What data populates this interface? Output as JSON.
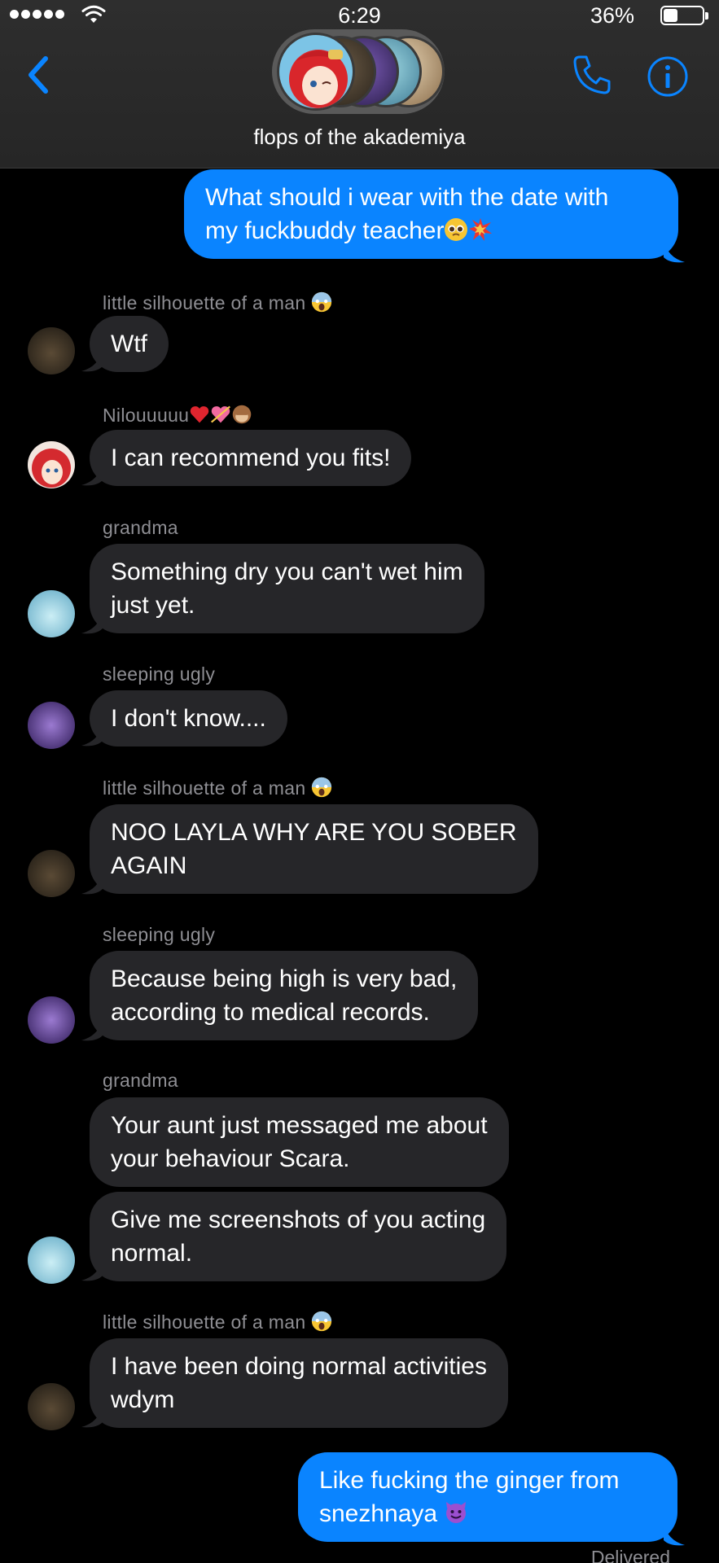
{
  "status_bar": {
    "time": "6:29",
    "battery": "36%",
    "battery_level": 0.36
  },
  "header": {
    "group_name": "flops of the akademiya"
  },
  "messages": [
    {
      "type": "outgoing",
      "text": "What should i wear with the date with my fuckbuddy teacher"
    },
    {
      "type": "incoming",
      "sender": "little silhouette of a man",
      "text": "Wtf"
    },
    {
      "type": "incoming",
      "sender": "Nilouuuuu",
      "text": "I can recommend you fits!"
    },
    {
      "type": "incoming",
      "sender": "grandma",
      "text": "Something dry you can't wet him just yet."
    },
    {
      "type": "incoming",
      "sender": "sleeping ugly",
      "text": "I don't know...."
    },
    {
      "type": "incoming",
      "sender": "little silhouette of a man",
      "text": "NOO LAYLA WHY ARE YOU SOBER AGAIN"
    },
    {
      "type": "incoming",
      "sender": "sleeping ugly",
      "text": "Because being high is very  bad, according to medical records."
    },
    {
      "type": "incoming",
      "sender": "grandma",
      "text": "Your aunt just messaged me about your behaviour Scara."
    },
    {
      "type": "incoming",
      "sender": "grandma",
      "text": "Give me screenshots of you acting normal."
    },
    {
      "type": "incoming",
      "sender": "little silhouette of a man",
      "text": "I have been doing normal activities wdym"
    },
    {
      "type": "outgoing",
      "text": "Like fucking the ginger from snezhnaya"
    }
  ],
  "msg_lines": {
    "m0": [
      "What should i wear with the date with",
      "my fuckbuddy teacher"
    ],
    "m3": [
      "Something dry you can't wet him",
      "just yet."
    ],
    "m5": [
      "NOO LAYLA WHY ARE YOU SOBER",
      "AGAIN"
    ],
    "m6": [
      "Because being high is very  bad,",
      "according to medical records."
    ],
    "m7": [
      "Your aunt just messaged me about",
      "your behaviour Scara."
    ],
    "m8": [
      "Give me screenshots of you acting",
      "normal."
    ],
    "m9": [
      "I have been doing normal activities",
      "wdym"
    ],
    "m10": [
      "Like fucking the ginger from",
      "snezhnaya"
    ]
  },
  "footer": {
    "delivered": "Delivered"
  },
  "icons": {
    "back": "chevron-left-icon",
    "phone": "phone-icon",
    "info": "info-icon",
    "scared": "face-screaming-in-fear-emoji",
    "pleading": "pleading-face-emoji",
    "collision": "collision-emoji",
    "devil": "smiling-face-with-horns-emoji"
  },
  "colors": {
    "accent": "#0a84ff",
    "incoming_bubble": "#262629",
    "background": "#000000",
    "meta_text": "#8e8e93"
  }
}
